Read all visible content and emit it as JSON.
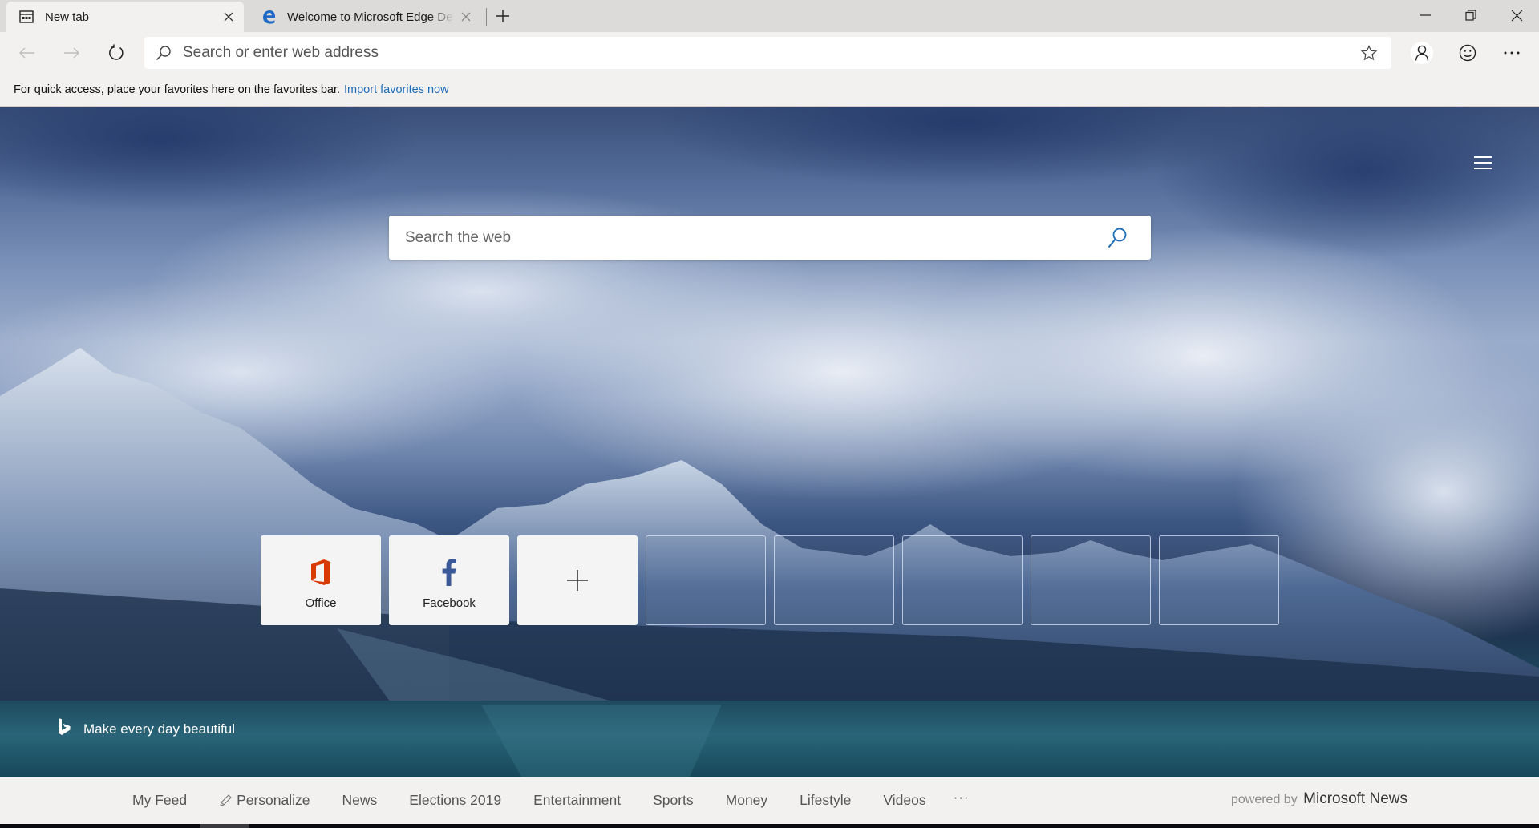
{
  "browser": {
    "tabs": [
      {
        "title": "New tab",
        "icon": "new-tab-page-icon",
        "active": true
      },
      {
        "title": "Welcome to Microsoft Edge Dev",
        "icon": "edge-logo-icon",
        "active": false
      }
    ],
    "new_tab_label": "+",
    "window_controls": [
      "minimize",
      "restore",
      "close"
    ],
    "address_bar": {
      "placeholder": "Search or enter web address",
      "value": ""
    },
    "toolbar_icons": [
      "back-icon",
      "forward-icon",
      "refresh-icon",
      "favorite-star-icon",
      "profile-icon",
      "feedback-smiley-icon",
      "more-icon"
    ]
  },
  "favorites_bar": {
    "message": "For quick access, place your favorites here on the favorites bar.",
    "link": "Import favorites now",
    "link_color": "#1e6bb8"
  },
  "new_tab_page": {
    "menu_icon": "hamburger-menu-icon",
    "search": {
      "placeholder": "Search the web",
      "value": "",
      "icon_color": "#1e6bb8"
    },
    "tiles": [
      {
        "label": "Office",
        "icon": "office-logo-icon",
        "color": "#d83b01"
      },
      {
        "label": "Facebook",
        "icon": "facebook-logo-icon",
        "color": "#3b5998"
      },
      {
        "label": "",
        "icon": "add-icon"
      },
      {
        "label": "",
        "icon": ""
      },
      {
        "label": "",
        "icon": ""
      },
      {
        "label": "",
        "icon": ""
      },
      {
        "label": "",
        "icon": ""
      },
      {
        "label": "",
        "icon": ""
      }
    ],
    "bing_credit": "Make every day beautiful"
  },
  "news_bar": {
    "items": [
      "My Feed",
      "Personalize",
      "News",
      "Elections 2019",
      "Entertainment",
      "Sports",
      "Money",
      "Lifestyle",
      "Videos"
    ],
    "more_label": "···",
    "powered_by": "powered by",
    "powered_brand": "Microsoft News"
  }
}
